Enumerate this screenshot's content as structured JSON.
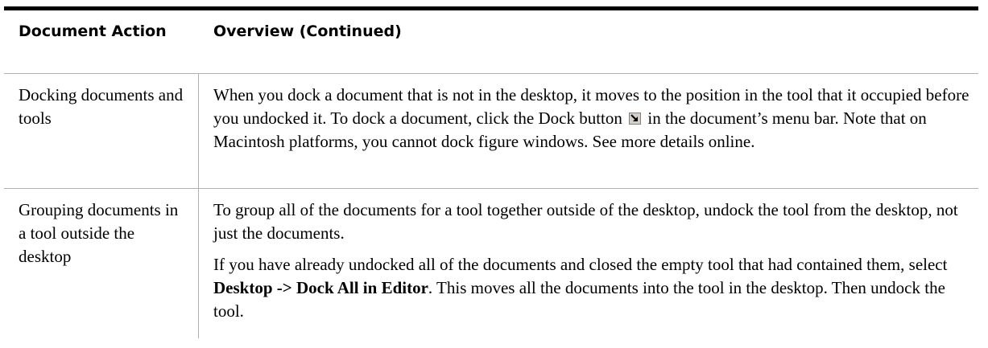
{
  "table": {
    "header": {
      "col1": "Document Action",
      "col2": "Overview (Continued)"
    },
    "rows": [
      {
        "action": "Docking documents and tools",
        "overview": {
          "before_icon": "When you dock a document that is not in the desktop, it moves to the position in the tool that it occupied before you undocked it. To dock a document, click the Dock button",
          "icon": "dock-icon",
          "after_icon": "in the document’s menu bar. Note that on Macintosh platforms, you cannot dock figure windows. See more details online."
        }
      },
      {
        "action": "Grouping documents in a tool outside the desktop",
        "overview": {
          "para1": "To group all of the documents for a tool together outside of the desktop, undock the tool from the desktop, not just the documents.",
          "para2_before": "If you have already undocked all of the documents and closed the empty tool that had contained them, select",
          "para2_bold": "Desktop -> Dock All in Editor",
          "para2_after": ". This moves all the documents into the tool in the desktop. Then undock the tool."
        }
      }
    ]
  }
}
